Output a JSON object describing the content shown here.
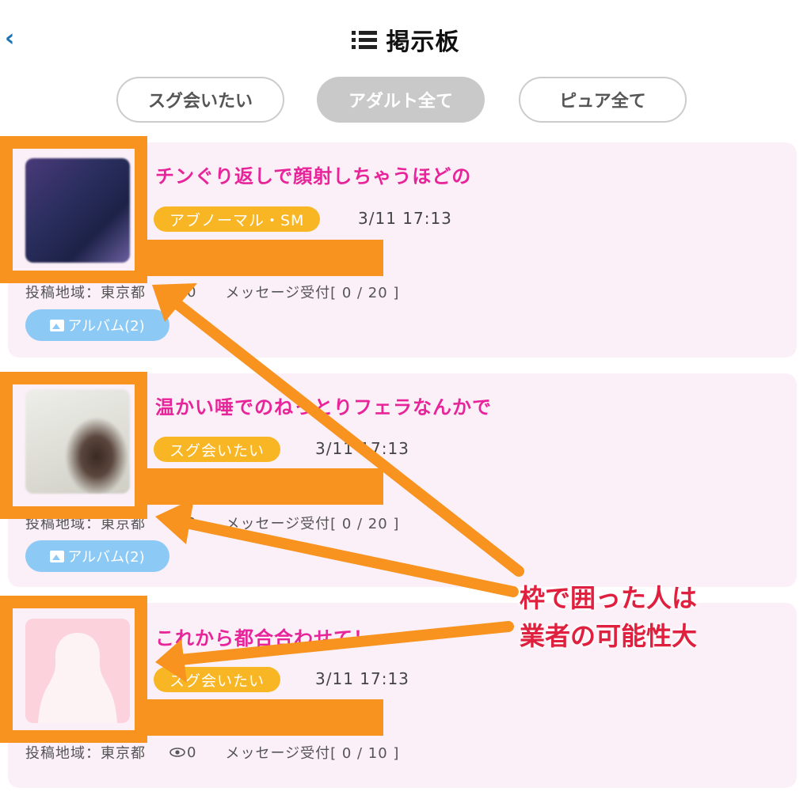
{
  "header": {
    "back_icon": "‹",
    "title": "掲示板"
  },
  "tabs": [
    {
      "label": "スグ会いたい",
      "active": false
    },
    {
      "label": "アダルト全て",
      "active": true
    },
    {
      "label": "ピュア全て",
      "active": false
    }
  ],
  "posts": [
    {
      "title": "チンぐり返しで顔射しちゃうほどの",
      "tag": "アブノーマル・SM",
      "date": "3/11 17:13",
      "region": "投稿地域：東京都",
      "views": "0",
      "messages": "メッセージ受付[ 0 / 20 ]",
      "album": "アルバム(2)"
    },
    {
      "title": "温かい唾でのねっとりフェラなんかで",
      "tag": "スグ会いたい",
      "date": "3/11 17:13",
      "region": "投稿地域：東京都",
      "views": "0",
      "messages": "メッセージ受付[ 0 / 20 ]",
      "album": "アルバム(2)"
    },
    {
      "title": "これから都合合わせて！",
      "tag": "スグ会いたい",
      "date": "3/11 17:13",
      "region": "投稿地域：東京都",
      "views": "0",
      "messages": "メッセージ受付[ 0 / 10 ]"
    }
  ],
  "annotation": {
    "line1": "枠で囲った人は",
    "line2": "業者の可能性大",
    "highlight_color": "#f7931e",
    "text_color": "#e0203f"
  },
  "colors": {
    "title_pink": "#e8249a",
    "tag_orange": "#f8b624",
    "album_blue": "#8cc9f5",
    "card_bg": "#fcf0f8",
    "back_blue": "#1b73b3"
  }
}
